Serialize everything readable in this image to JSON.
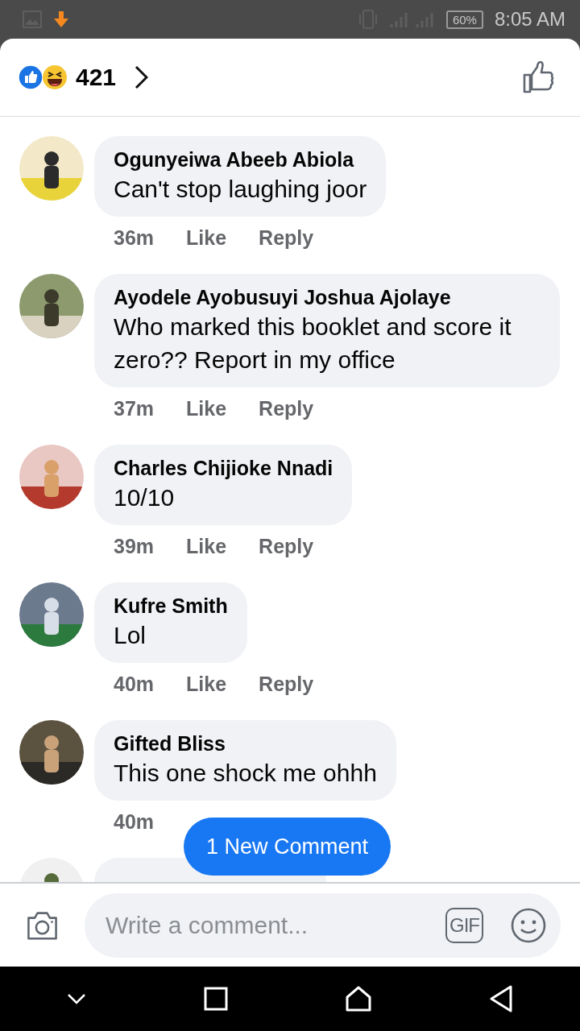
{
  "status_bar": {
    "time": "8:05 AM",
    "battery": "60%"
  },
  "header": {
    "reaction_count": "421"
  },
  "comments": [
    {
      "author": "Ogunyeiwa Abeeb Abiola",
      "text": "Can't stop laughing joor",
      "time": "36m",
      "actions": [
        "Like",
        "Reply"
      ]
    },
    {
      "author": "Ayodele Ayobusuyi Joshua Ajolaye",
      "text": "Who marked this booklet and score it zero?? Report in my office",
      "time": "37m",
      "actions": [
        "Like",
        "Reply"
      ]
    },
    {
      "author": "Charles Chijioke Nnadi",
      "text": "10/10",
      "time": "39m",
      "actions": [
        "Like",
        "Reply"
      ]
    },
    {
      "author": "Kufre Smith",
      "text": "Lol",
      "time": "40m",
      "actions": [
        "Like",
        "Reply"
      ]
    },
    {
      "author": "Gifted Bliss",
      "text": "This one shock me ohhh",
      "time": "40m"
    },
    {
      "kind": "cut_off"
    }
  ],
  "new_comment_button": "1 New Comment",
  "composer": {
    "placeholder": "Write a comment...",
    "gif": "GIF"
  }
}
